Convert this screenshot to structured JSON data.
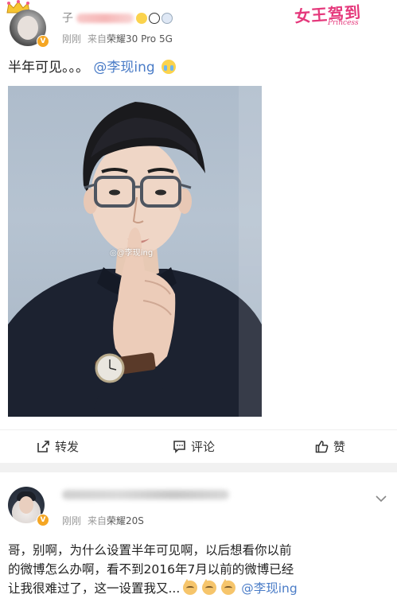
{
  "post1": {
    "author": {
      "name_visible_char": "子",
      "emoji_badges": [
        "surprised-face",
        "panda",
        "diamond"
      ]
    },
    "meta": {
      "time": "刚刚",
      "source_prefix": "来自",
      "source_device": "荣耀30 Pro 5G"
    },
    "watermark_logo": {
      "main": "女王驾到",
      "sub": "Princess"
    },
    "content": {
      "text": "半年可见。。。",
      "mention": "@李现ing",
      "emoji": "crying-face"
    },
    "image": {
      "watermark": "@李现ing"
    },
    "actions": {
      "repost": "转发",
      "comment": "评论",
      "like": "赞"
    }
  },
  "post2": {
    "meta": {
      "time": "刚刚",
      "source_prefix": "来自",
      "source_device": "荣耀20S"
    },
    "content": {
      "line1": "哥，别啊，为什么设置半年可见啊，以后想看你以前",
      "line2": "的微博怎么办啊，看不到2016年7月以前的微博已经",
      "line3_text": "让我很难过了，这一设置我又...",
      "line3_emojis": [
        "cat-face",
        "cat-face",
        "cat-face"
      ],
      "mention": "@李现ing"
    }
  },
  "colors": {
    "mention_blue": "#4a7cc7",
    "verified_orange": "#f5a623",
    "logo_pink": "#e5397c",
    "separator_gray": "#f1f1f1"
  }
}
